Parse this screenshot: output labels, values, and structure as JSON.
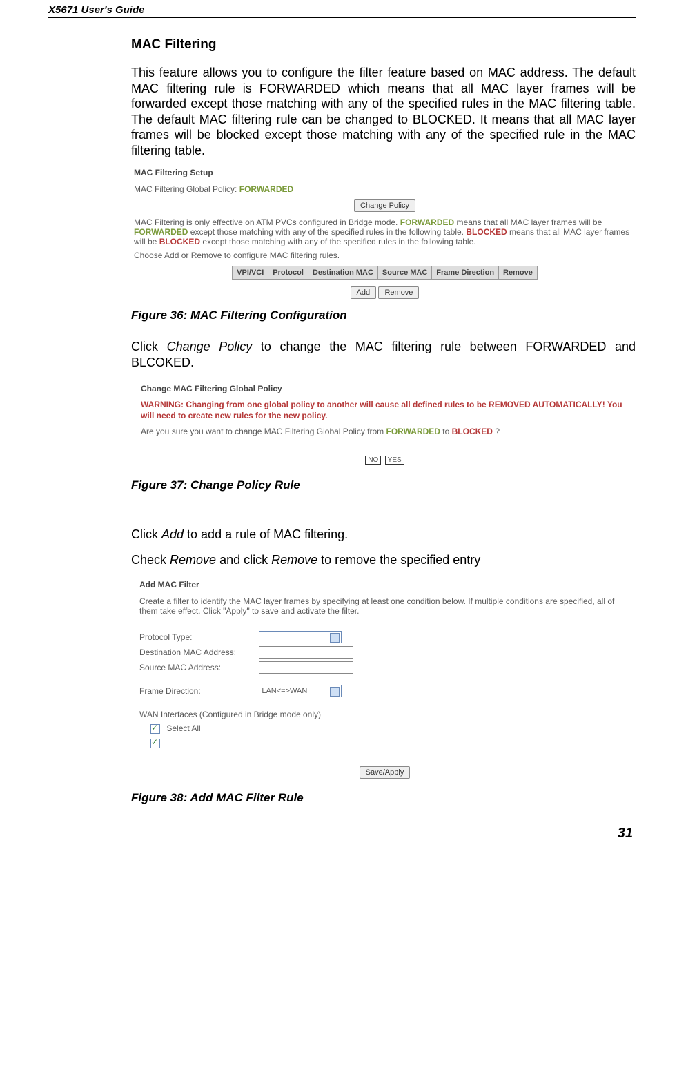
{
  "header": {
    "title": "X5671 User's Guide"
  },
  "section": {
    "heading": "MAC Filtering"
  },
  "para1": "This feature allows you to configure the filter feature based on MAC address. The default MAC filtering rule is FORWARDED which means that all MAC layer frames will be forwarded except those matching with any of the specified rules in the MAC filtering table. The default MAC filtering rule can be changed to BLOCKED. It means that all MAC layer frames will be blocked except those matching with any of the specified rule in the MAC filtering table.",
  "fig36": {
    "title": "MAC Filtering Setup",
    "policy_label": "MAC Filtering Global Policy:",
    "policy_value": "FORWARDED",
    "change_btn": "Change Policy",
    "desc_prefix": "MAC Filtering is only effective on ATM PVCs configured in Bridge mode. ",
    "desc_fwd1": "FORWARDED",
    "desc_mid1": " means that all MAC layer frames will be ",
    "desc_fwd2": "FORWARDED",
    "desc_mid2": " except those matching with any of the specified rules in the following table. ",
    "desc_blk1": "BLOCKED",
    "desc_mid3": " means that all MAC layer frames will be ",
    "desc_blk2": "BLOCKED",
    "desc_mid4": " except those matching with any of the specified rules in the following table.",
    "choose": "Choose Add or Remove to configure MAC filtering rules.",
    "cols": [
      "VPI/VCI",
      "Protocol",
      "Destination MAC",
      "Source MAC",
      "Frame Direction",
      "Remove"
    ],
    "add_btn": "Add",
    "remove_btn": "Remove",
    "caption": "Figure 36: MAC Filtering Configuration"
  },
  "para2_pre": "Click ",
  "para2_ital": "Change Policy",
  "para2_post": " to change the MAC filtering rule between FORWARDED and BLCOKED.",
  "fig37": {
    "title": "Change MAC Filtering Global Policy",
    "warn": "WARNING: Changing from one global policy to another will cause all defined rules to be REMOVED AUTOMATICALLY! You will need to create new rules for the new policy.",
    "confirm_pre": "Are you sure you want to change MAC Filtering Global Policy from ",
    "confirm_fwd": "FORWARDED",
    "confirm_mid": " to ",
    "confirm_blk": "BLOCKED",
    "confirm_post": " ?",
    "no": "NO",
    "yes": "YES",
    "caption": "Figure 37: Change Policy Rule"
  },
  "para3_pre": "Click ",
  "para3_ital": "Add",
  "para3_post": " to add a rule of MAC filtering.",
  "para4_pre": "Check ",
  "para4_ital1": "Remove",
  "para4_mid": " and click ",
  "para4_ital2": "Remove",
  "para4_post": " to remove the specified entry",
  "fig38": {
    "title": "Add MAC Filter",
    "desc": "Create a filter to identify the MAC layer frames by specifying at least one condition below. If multiple conditions are specified, all of them take effect. Click \"Apply\" to save and activate the filter.",
    "protocol": "Protocol Type:",
    "dest": "Destination MAC Address:",
    "src": "Source MAC Address:",
    "frame": "Frame Direction:",
    "frame_val": "LAN<=>WAN",
    "wan": "WAN Interfaces (Configured in Bridge mode only)",
    "select_all": "Select All",
    "save": "Save/Apply",
    "caption": "Figure 38: Add MAC Filter Rule"
  },
  "page_number": "31"
}
